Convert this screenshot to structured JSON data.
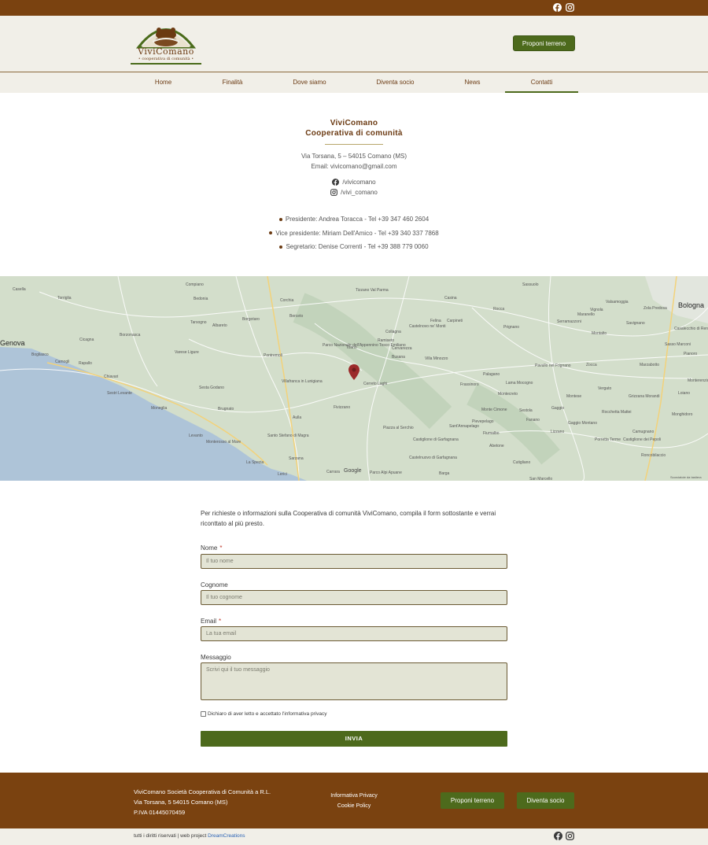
{
  "brand": {
    "name": "ViviComano",
    "tagline": "• cooperativa di comunità •"
  },
  "header": {
    "cta_label": "Proponi terreno"
  },
  "nav": {
    "items": [
      {
        "label": "Home"
      },
      {
        "label": "Finalità"
      },
      {
        "label": "Dove siamo"
      },
      {
        "label": "Diventa socio"
      },
      {
        "label": "News"
      },
      {
        "label": "Contatti"
      }
    ],
    "active": "Contatti"
  },
  "contact": {
    "title_line1": "ViviComano",
    "title_line2": "Cooperativa di comunità",
    "address": "Via Torsana, 5 – 54015 Comano (MS)",
    "email": "Email: vivicomano@gmail.com",
    "facebook": "/vivicomano",
    "instagram": "/vivi_comano",
    "people": [
      "Presidente: Andrea Toracca - Tel +39 347 460 2604",
      "Vice presidente: Miriam Dell'Amico - Tel +39 340 337 7868",
      "Segretario: Denise Correnti - Tel +39 388 779 0060"
    ]
  },
  "map": {
    "labels": [
      "Genova",
      "Bologna",
      "La Spezia",
      "Sarzana",
      "Aulla",
      "Fivizzano",
      "Villafranca in Lunigiana",
      "Pontremoli",
      "Borgotaro",
      "Bedonia",
      "Corchia",
      "Berceto",
      "Tizzano Val Parma",
      "Casina",
      "Carpineti",
      "Castelnovo ne' Monti",
      "Busana",
      "Villa Minozzo",
      "Cerreto Laghi",
      "Monte Cimone",
      "Fanano",
      "Sestola",
      "Pievepelago",
      "Fiumalbo",
      "Abetone",
      "Castelnuovo di Garfagnana",
      "Piazza al Serchio",
      "Chiavari",
      "Sestri Levante",
      "Rapallo",
      "Camogli",
      "Bogliasco",
      "Moneglia",
      "Levanto",
      "Monterosso al Mare",
      "Lerici",
      "Carrara",
      "Parco Alpi Apuane",
      "Parco Nazionale dell'Appennino Tosco Emiliano",
      "Sassuolo",
      "Maranello",
      "Vignola",
      "Zola Predosa",
      "Zocca",
      "Vergato",
      "Porretta Terme",
      "Marzabotto",
      "Pavullo nel Frignano",
      "Lama Mocogno",
      "Montese",
      "Gaggio Montano",
      "Sasso Marconi",
      "Casalecchio di Reno",
      "Pianoro",
      "Loiano",
      "Monghidoro",
      "Castiglione dei Pepoli",
      "Roncobilaccio",
      "Castiglione di Garfagnana",
      "Barga",
      "San Marcello",
      "Cutigliano",
      "Varese Ligure",
      "Sesta Godano",
      "Brugnato",
      "Santo Stefano di Magra",
      "Albareto",
      "Tarsogno",
      "Compiano",
      "Borzonasca",
      "Cicagna",
      "Torriglia",
      "Casella",
      "Monterenzio",
      "Frassinoro",
      "Palagano",
      "Montecreto",
      "Sant'Annapelago",
      "Toano",
      "Ramiseto",
      "Cervarezza",
      "Collagna",
      "Felina",
      "Rocca",
      "Prignano",
      "Serramazzoni",
      "Valsamoggia",
      "Savignano",
      "Montalto",
      "Grizzana Morandi",
      "Camugnano",
      "Rocchetta Mattei",
      "Gaggio",
      "Lizzano"
    ],
    "attribution": "Google",
    "scale": "Scorciatoie da tastiera"
  },
  "form": {
    "intro": "Per richieste o informazioni sulla Cooperativa di comunità ViviComano, compila il form sottostante e verrai riconttato al più presto.",
    "fields": [
      {
        "label": "Nome",
        "placeholder": "Il tuo nome",
        "required": true
      },
      {
        "label": "Cognome",
        "placeholder": "Il tuo cognome",
        "required": false
      },
      {
        "label": "Email",
        "placeholder": "La tua email",
        "required": true
      },
      {
        "label": "Messaggio",
        "placeholder": "Scrivi qui il tuo messaggio",
        "required": false
      }
    ],
    "required_mark": "*",
    "privacy": "Dichiaro di aver letto e accettato l'informativa privacy",
    "submit": "INVIA"
  },
  "footer": {
    "org_line1": "ViviComano Società Cooperativa di Comunità a R.L.",
    "org_line2": "Via Torsana, 5 54015 Comano (MS)",
    "org_line3": "P.IVA 01445070459",
    "privacy_link": "Informativa Privacy",
    "cookie_link": "Cookie Policy",
    "btn_proponi": "Proponi terreno",
    "btn_socio": "Diventa socio"
  },
  "bottom": {
    "rights": "tutti i diritti riservati | web project",
    "agency": "DreamCreations"
  },
  "colors": {
    "brown": "#7a4210",
    "green": "#4d6a1c",
    "cream": "#f1efe8",
    "field": "#e3e4d5"
  },
  "icons": [
    "facebook-icon",
    "instagram-icon",
    "map-pin-icon",
    "bullet-dot-icon"
  ]
}
